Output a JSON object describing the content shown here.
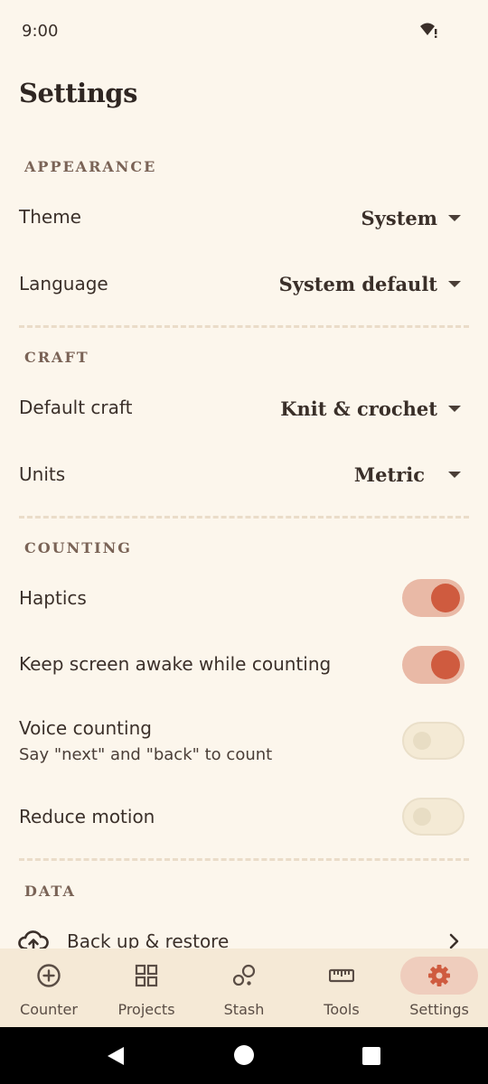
{
  "status_bar": {
    "time": "9:00",
    "wifi_icon": "wifi-alert-icon"
  },
  "page_title": "Settings",
  "sections": {
    "appearance": {
      "header": "APPEARANCE",
      "theme": {
        "label": "Theme",
        "value": "System"
      },
      "language": {
        "label": "Language",
        "value": "System default"
      }
    },
    "craft": {
      "header": "CRAFT",
      "default_craft": {
        "label": "Default craft",
        "value": "Knit & crochet"
      },
      "units": {
        "label": "Units",
        "value": "Metric"
      }
    },
    "counting": {
      "header": "COUNTING",
      "haptics": {
        "label": "Haptics",
        "on": true
      },
      "keep_awake": {
        "label": "Keep screen awake while counting",
        "on": true
      },
      "voice_counting": {
        "label": "Voice counting",
        "sublabel": "Say \"next\" and \"back\" to count",
        "on": false
      },
      "reduce_motion": {
        "label": "Reduce motion",
        "on": false
      }
    },
    "data": {
      "header": "DATA",
      "backup": {
        "label": "Back up & restore",
        "icon": "cloud-upload-icon"
      }
    }
  },
  "bottom_nav": {
    "active": "settings",
    "items": [
      {
        "label": "Counter",
        "icon": "plus-circle-icon"
      },
      {
        "label": "Projects",
        "icon": "grid-icon"
      },
      {
        "label": "Stash",
        "icon": "yarn-balls-icon"
      },
      {
        "label": "Tools",
        "icon": "ruler-icon"
      },
      {
        "label": "Settings",
        "icon": "gear-icon"
      }
    ]
  },
  "colors": {
    "background": "#fcf6ec",
    "accent": "#cf5b3f",
    "toggle_track_on": "#e9b9a6",
    "nav_background": "#f5e9d6",
    "nav_active_pill": "#efcdbd",
    "divider": "#eadcc9"
  }
}
